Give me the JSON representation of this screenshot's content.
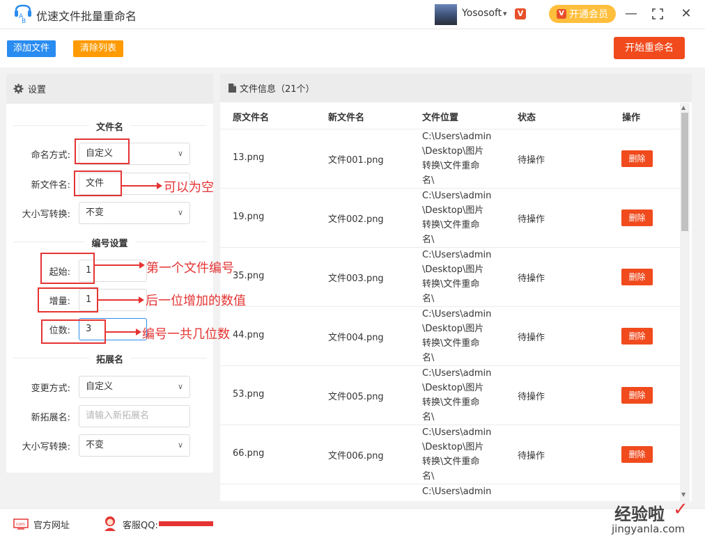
{
  "app": {
    "title": "优速文件批量重命名",
    "icon_text": "AB"
  },
  "user": {
    "name": "Yososoft",
    "vip_label": "开通会员"
  },
  "toolbar": {
    "add_files": "添加文件",
    "clear_list": "清除列表",
    "start_rename": "开始重命名"
  },
  "settings": {
    "header": "设置",
    "filename_section": "文件名",
    "naming_mode_label": "命名方式:",
    "naming_mode_value": "自定义",
    "new_name_label": "新文件名:",
    "new_name_value": "文件",
    "case_label": "大小写转换:",
    "case_value": "不变",
    "numbering_section": "编号设置",
    "start_label": "起始:",
    "start_value": "1",
    "step_label": "增量:",
    "step_value": "1",
    "digits_label": "位数:",
    "digits_value": "3",
    "ext_section": "拓展名",
    "ext_mode_label": "变更方式:",
    "ext_mode_value": "自定义",
    "new_ext_label": "新拓展名:",
    "new_ext_placeholder": "请输入新拓展名",
    "ext_case_label": "大小写转换:",
    "ext_case_value": "不变"
  },
  "files": {
    "header": "文件信息（21个）",
    "columns": [
      "原文件名",
      "新文件名",
      "文件位置",
      "状态",
      "操作"
    ],
    "rows": [
      {
        "orig": "13.png",
        "new": "文件001.png",
        "path": [
          "C:\\Users\\admin",
          "\\Desktop\\图片",
          "转换\\文件重命",
          "名\\"
        ],
        "status": "待操作",
        "action": "删除"
      },
      {
        "orig": "19.png",
        "new": "文件002.png",
        "path": [
          "C:\\Users\\admin",
          "\\Desktop\\图片",
          "转换\\文件重命",
          "名\\"
        ],
        "status": "待操作",
        "action": "删除"
      },
      {
        "orig": "35.png",
        "new": "文件003.png",
        "path": [
          "C:\\Users\\admin",
          "\\Desktop\\图片",
          "转换\\文件重命",
          "名\\"
        ],
        "status": "待操作",
        "action": "删除"
      },
      {
        "orig": "44.png",
        "new": "文件004.png",
        "path": [
          "C:\\Users\\admin",
          "\\Desktop\\图片",
          "转换\\文件重命",
          "名\\"
        ],
        "status": "待操作",
        "action": "删除"
      },
      {
        "orig": "53.png",
        "new": "文件005.png",
        "path": [
          "C:\\Users\\admin",
          "\\Desktop\\图片",
          "转换\\文件重命",
          "名\\"
        ],
        "status": "待操作",
        "action": "删除"
      },
      {
        "orig": "66.png",
        "new": "文件006.png",
        "path": [
          "C:\\Users\\admin",
          "\\Desktop\\图片",
          "转换\\文件重命",
          "名\\"
        ],
        "status": "待操作",
        "action": "删除"
      },
      {
        "orig": "",
        "new": "",
        "path": [
          "C:\\Users\\admin"
        ],
        "status": "",
        "action": ""
      }
    ]
  },
  "annotations": {
    "empty_ok": "可以为空",
    "first_number": "第一个文件编号",
    "increment": "后一位增加的数值",
    "digits": "编号一共几位数"
  },
  "footer": {
    "website": "官方网址",
    "support": "客服QQ:"
  },
  "watermark": {
    "line1": "经验啦",
    "line2": "jingyanla.com"
  },
  "colors": {
    "accent_blue": "#2a8cf0",
    "accent_orange": "#ff9a00",
    "accent_red": "#f04a1d",
    "annotation_red": "#e53333",
    "vip_yellow": "#ffbf3c"
  }
}
